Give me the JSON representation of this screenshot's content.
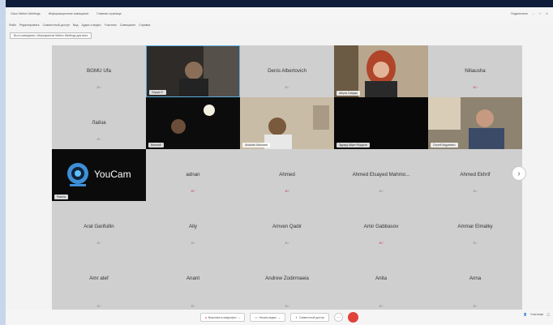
{
  "title_bar": {
    "items": [
      "Cisco Webex Meetings",
      "Информационное совещание",
      "Главная страница"
    ],
    "right_items": [
      "Подключено",
      "–",
      "□",
      "✕"
    ]
  },
  "menu": {
    "items": [
      "Файл",
      "Редактировать",
      "Совместный доступ",
      "Вид",
      "Аудио и видео",
      "Участник",
      "Совещание",
      "Справка"
    ]
  },
  "meeting_chip": "Вы в совещании • Мероприятие Webex Meetings для всех",
  "participants": {
    "bgmu": "BGMU Ufa",
    "denis": "Denis Albertovich",
    "niliausha": "Niliausha",
    "laisa": "Лайза",
    "adnan": "adnan",
    "ahmed": "Ahmed",
    "ahmed_elsayed": "Ahmed Elsayed Mahmo...",
    "ahmed_ekhrif": "Ahmed Ekhrif",
    "arat": "Arat Garifullin",
    "aliy": "Aliy",
    "amven": "Amven Qadir",
    "amir": "Amir Gabbasov",
    "ammar": "Ammar Elmalky",
    "amr": "Amr atef",
    "anant": "Anant",
    "andrew": "Andrew Zodirmaeia",
    "anita": "Anita",
    "anna": "Anna"
  },
  "video_tags": {
    "v1": "Ларцев Е.",
    "v2": "Айгуль Сайдаш",
    "v3": "Виталий",
    "v4": "Abdullahi Mohamed",
    "v5": "Эдуард Айрат Фёдоров",
    "v6": "Сергей Андреевич",
    "v7": "Рамиль"
  },
  "youcam_label": "YouCam",
  "bottom": {
    "mute": "Выключить микрофон",
    "video": "Начать видео",
    "share": "Совместный доступ",
    "more": "···",
    "participants": "Участники"
  }
}
